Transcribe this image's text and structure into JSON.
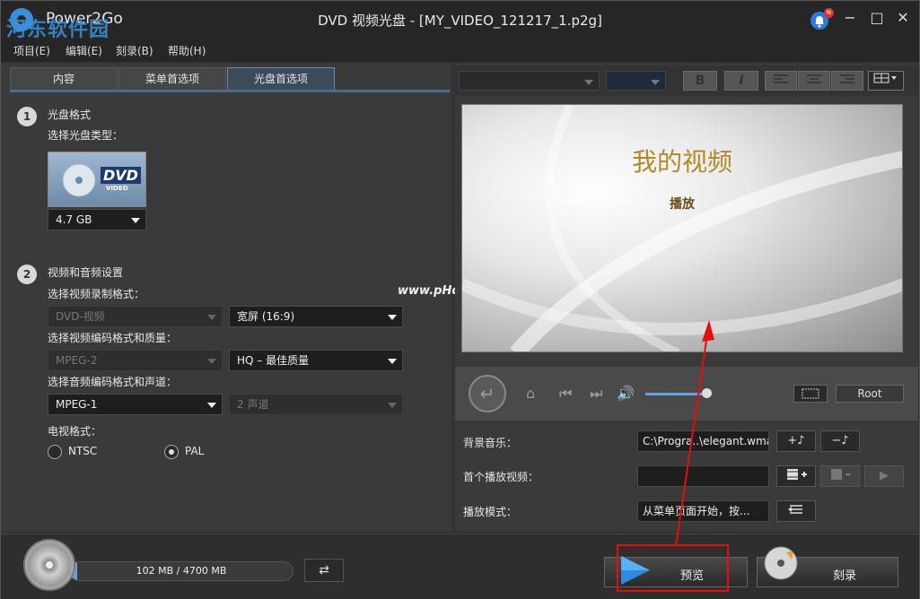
{
  "window": {
    "app_name": "Power2Go",
    "title": "DVD 视频光盘 - [MY_VIDEO_121217_1.p2g]",
    "bell_badge": "N",
    "minimize": "−",
    "maximize": "□",
    "close": "✕"
  },
  "watermark": {
    "title_text": "河东软件园",
    "url_text": "www.pHome.NET"
  },
  "menu": {
    "items": [
      {
        "label": "项目(E)"
      },
      {
        "label": "编辑(E)"
      },
      {
        "label": "刻录(B)"
      },
      {
        "label": "帮助(H)"
      }
    ]
  },
  "tabs": [
    {
      "label": "内容"
    },
    {
      "label": "菜单首选项"
    },
    {
      "label": "光盘首选项"
    }
  ],
  "disc_format": {
    "step": "1",
    "heading": "光盘格式",
    "choose_type": "选择光盘类型：",
    "disc_icon_label": "DVD",
    "disc_icon_sub": "VIDEO",
    "size": "4.7 GB"
  },
  "av_settings": {
    "step": "2",
    "heading": "视频和音频设置",
    "video_format_label": "选择视频录制格式：",
    "video_format": "DVD-视频",
    "aspect": "宽屏 (16:9)",
    "codec_label": "选择视频编码格式和质量：",
    "codec": "MPEG-2",
    "quality": "HQ – 最佳质量",
    "audio_label": "选择音频编码格式和声道：",
    "audio_codec": "MPEG-1",
    "audio_channels": "2 声道",
    "tv_label": "电视格式：",
    "ntsc": "NTSC",
    "pal": "PAL"
  },
  "toolbar": {
    "bold": "B",
    "italic": "I"
  },
  "preview": {
    "title": "我的视频",
    "play": "播放"
  },
  "player": {
    "root": "Root",
    "volume_level": 0.75
  },
  "settings": {
    "bg_music_label": "背景音乐：",
    "bg_music_value": "C:\\Progra..\\elegant.wma",
    "first_play_label": "首个播放视频：",
    "first_play_value": "",
    "play_mode_label": "播放模式：",
    "play_mode_value": "从菜单页面开始，按..."
  },
  "bottom": {
    "capacity_text": "102 MB / 4700 MB",
    "capacity_used": 0.0217,
    "preview_label": "预览",
    "burn_label": "刻录"
  }
}
